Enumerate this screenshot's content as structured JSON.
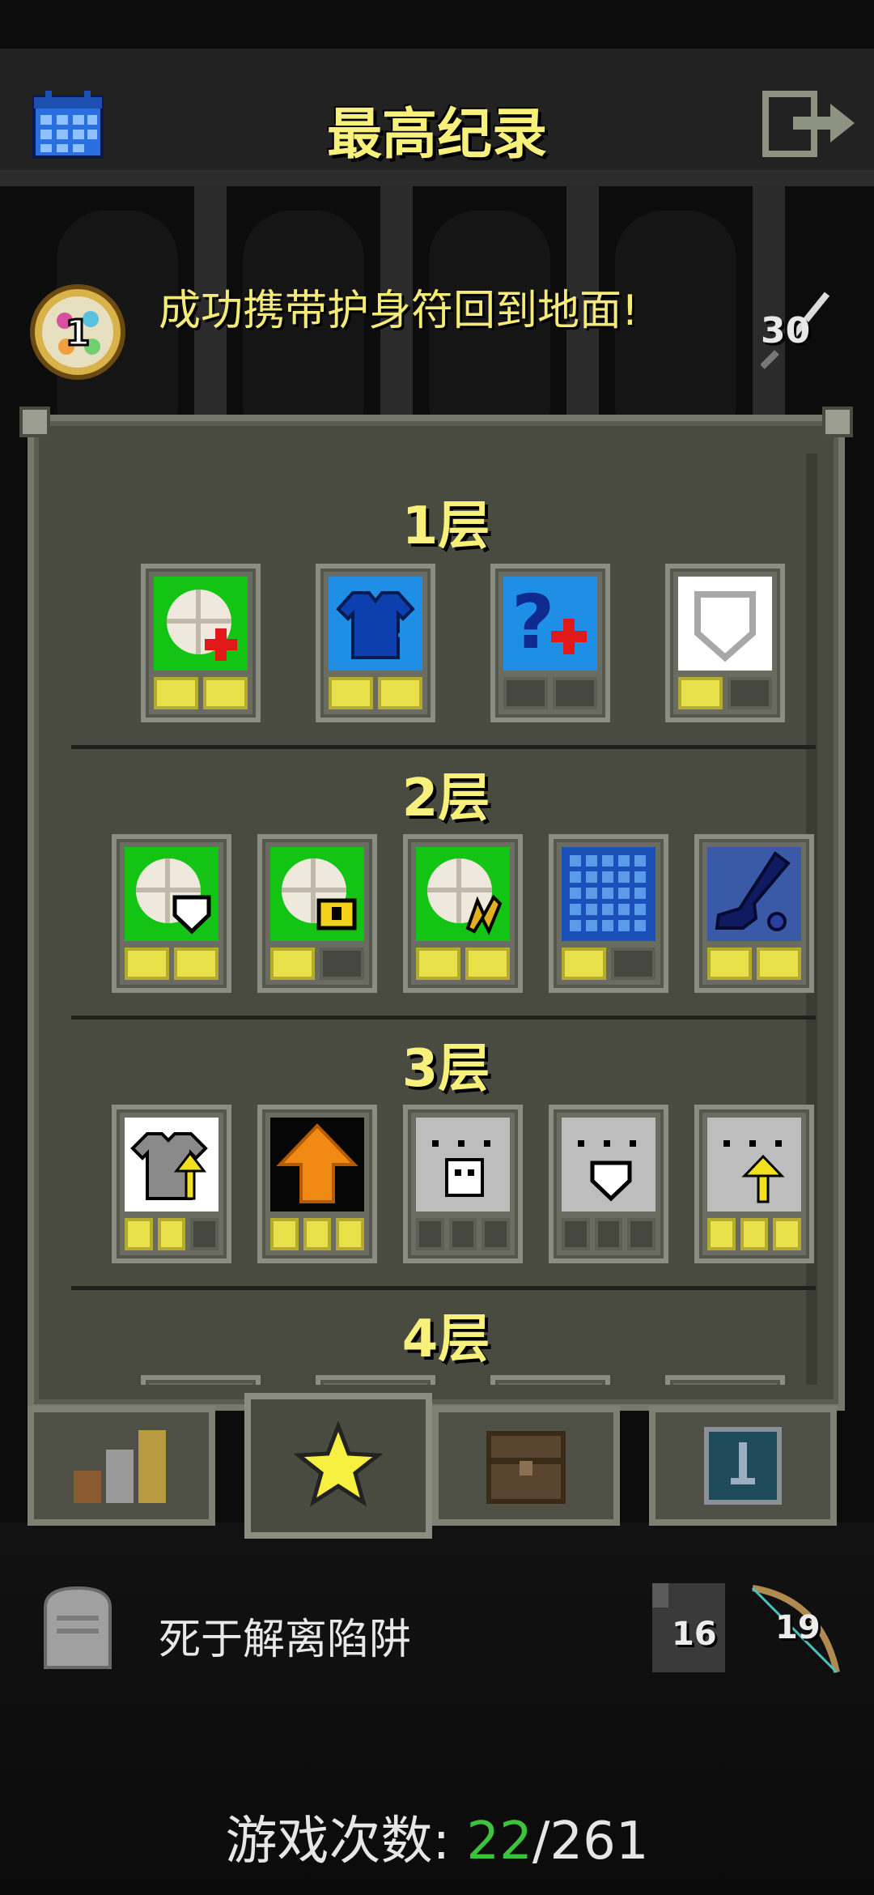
{
  "header": {
    "title": "最高纪录",
    "calendar_icon": "calendar-icon",
    "exit_icon": "exit-icon"
  },
  "record": {
    "badge_rank": "1",
    "message": "成功携带护身符回到地面!",
    "score": "30"
  },
  "floors": [
    {
      "title": "1层",
      "items": [
        {
          "icon": "heal-potion-icon",
          "pips": [
            1,
            1
          ]
        },
        {
          "icon": "blue-armor-icon",
          "pips": [
            1,
            1
          ]
        },
        {
          "icon": "unknown-heal-icon",
          "pips": [
            0,
            0
          ]
        },
        {
          "icon": "white-shield-icon",
          "pips": [
            1,
            0
          ]
        }
      ]
    },
    {
      "title": "2层",
      "items": [
        {
          "icon": "shield-scroll-icon",
          "pips": [
            1,
            1
          ]
        },
        {
          "icon": "gold-scroll-icon",
          "pips": [
            1,
            0
          ]
        },
        {
          "icon": "yellow-rune-scroll-icon",
          "pips": [
            1,
            1
          ]
        },
        {
          "icon": "grid-map-icon",
          "pips": [
            1,
            0
          ]
        },
        {
          "icon": "blue-boot-icon",
          "pips": [
            1,
            1
          ]
        }
      ]
    },
    {
      "title": "3层",
      "items": [
        {
          "icon": "chainmail-up-icon",
          "pips": [
            1,
            1,
            0
          ]
        },
        {
          "icon": "orange-arrow-icon",
          "pips": [
            1,
            1,
            1
          ]
        },
        {
          "icon": "skull-stone-icon",
          "pips": [
            0,
            0,
            0
          ]
        },
        {
          "icon": "shield-stone-icon",
          "pips": [
            0,
            0,
            0
          ]
        },
        {
          "icon": "arrow-stone-icon",
          "pips": [
            1,
            1,
            1
          ]
        }
      ]
    },
    {
      "title": "4层",
      "items": []
    }
  ],
  "tabs": [
    {
      "name": "tab-stats",
      "icon": "stats-bars-icon"
    },
    {
      "name": "tab-records",
      "icon": "star-icon",
      "active": true
    },
    {
      "name": "tab-chest",
      "icon": "chest-icon"
    },
    {
      "name": "tab-badges",
      "icon": "sword-badge-icon"
    }
  ],
  "death": {
    "text": "死于解离陷阱"
  },
  "stats": {
    "depth": "16",
    "level": "19"
  },
  "games": {
    "label": "游戏次数: ",
    "current": "22",
    "separator": "/",
    "total": "261"
  },
  "colors": {
    "title_yellow": "#f7f07a",
    "panel": "#494b41",
    "pip_on": "#e9e14a",
    "games_current": "#3cc23c"
  }
}
